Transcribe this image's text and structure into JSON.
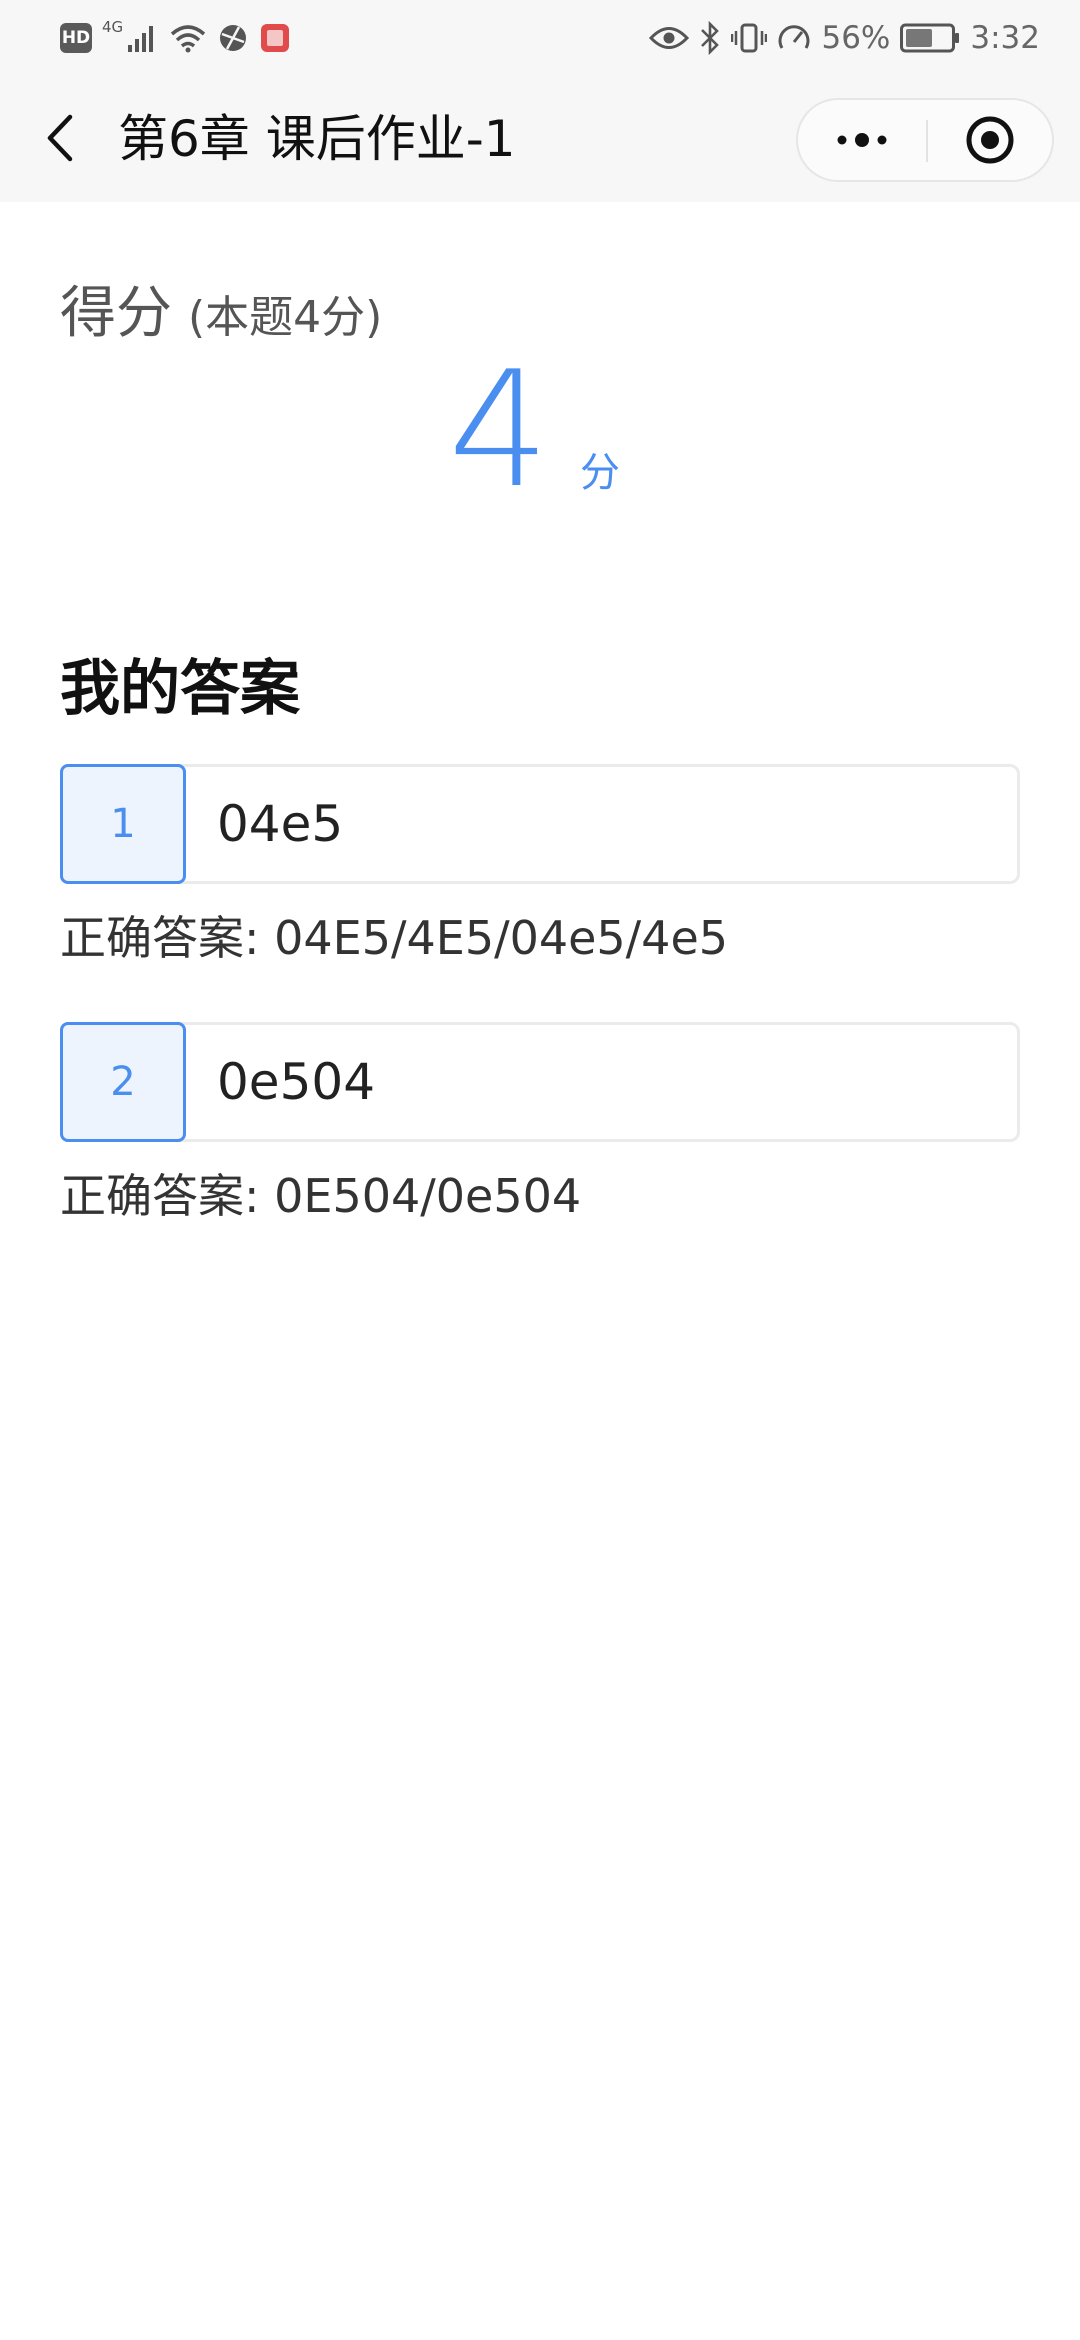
{
  "status_bar": {
    "hd": "HD",
    "network": "4G",
    "battery": "56%",
    "time": "3:32"
  },
  "nav": {
    "title": "第6章 课后作业-1"
  },
  "score": {
    "label": "得分",
    "note": "(本题4分)",
    "value": "4",
    "unit": "分"
  },
  "answers_section": {
    "title": "我的答案",
    "items": [
      {
        "number": "1",
        "answer": "04e5",
        "correct": "正确答案: 04E5/4E5/04e5/4e5"
      },
      {
        "number": "2",
        "answer": "0e504",
        "correct": "正确答案: 0E504/0e504"
      }
    ]
  },
  "colors": {
    "accent": "#4a8ef0",
    "accent_bg": "#eef4fe",
    "bar_bg": "#f7f7f7"
  }
}
